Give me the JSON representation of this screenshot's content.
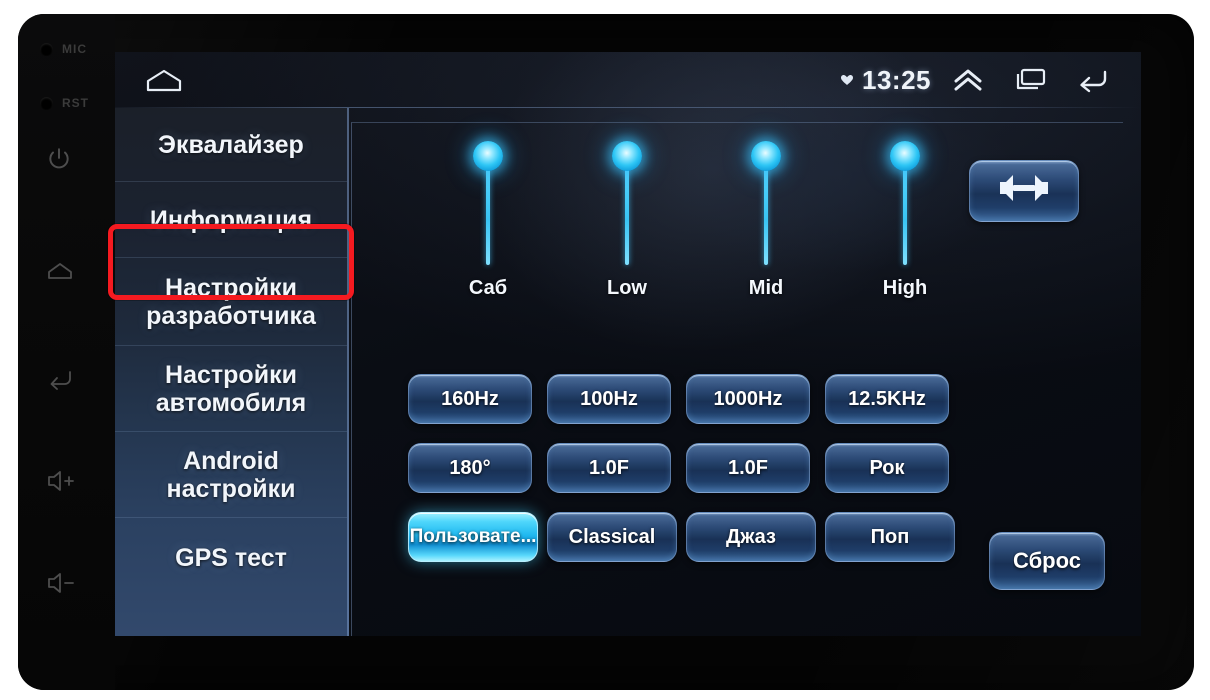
{
  "device": {
    "bezel_buttons": [
      {
        "name": "mic",
        "label": "MIC",
        "kind": "hole"
      },
      {
        "name": "reset",
        "label": "RST",
        "kind": "hole"
      },
      {
        "name": "power",
        "label": "",
        "kind": "icon"
      },
      {
        "name": "home",
        "label": "",
        "kind": "icon"
      },
      {
        "name": "back",
        "label": "",
        "kind": "icon"
      },
      {
        "name": "volume-up",
        "label": "",
        "kind": "icon"
      },
      {
        "name": "volume-down",
        "label": "",
        "kind": "icon"
      }
    ]
  },
  "statusbar": {
    "home_icon": "home-icon",
    "bluetooth_icon": "bluetooth-icon",
    "time": "13:25",
    "expand_icon": "double-chevron-up-icon",
    "recents_icon": "recent-apps-icon",
    "back_icon": "back-arrow-icon"
  },
  "sidebar": {
    "items": [
      {
        "label": "Эквалайзер",
        "lines": [
          "Эквалайзер"
        ],
        "selected": false,
        "highlighted": false
      },
      {
        "label": "Информация",
        "lines": [
          "Информация"
        ],
        "selected": false,
        "highlighted": true
      },
      {
        "label": "Настройки разработчика",
        "lines": [
          "Настройки",
          "разработчика"
        ],
        "selected": false,
        "highlighted": false
      },
      {
        "label": "Настройки автомобиля",
        "lines": [
          "Настройки",
          "автомобиля"
        ],
        "selected": false,
        "highlighted": false
      },
      {
        "label": "Android настройки",
        "lines": [
          "Android",
          "настройки"
        ],
        "selected": false,
        "highlighted": false
      },
      {
        "label": "GPS тест",
        "lines": [
          "GPS тест"
        ],
        "selected": false,
        "highlighted": false
      }
    ]
  },
  "equalizer": {
    "sliders": [
      {
        "label": "Саб",
        "value": 100
      },
      {
        "label": "Low",
        "value": 100
      },
      {
        "label": "Mid",
        "value": 100
      },
      {
        "label": "High",
        "value": 100
      }
    ],
    "rows": [
      [
        {
          "label": "160Hz",
          "active": false
        },
        {
          "label": "100Hz",
          "active": false
        },
        {
          "label": "1000Hz",
          "active": false
        },
        {
          "label": "12.5KHz",
          "active": false
        }
      ],
      [
        {
          "label": "180°",
          "active": false
        },
        {
          "label": "1.0F",
          "active": false
        },
        {
          "label": "1.0F",
          "active": false
        },
        {
          "label": "Рок",
          "active": false
        }
      ],
      [
        {
          "label": "Пользовате...",
          "active": true
        },
        {
          "label": "Classical",
          "active": false
        },
        {
          "label": "Джаз",
          "active": false
        },
        {
          "label": "Поп",
          "active": false
        }
      ]
    ],
    "balance_button": {
      "icon": "balance-speakers-icon",
      "label": ""
    },
    "reset_button": {
      "label": "Сброс"
    }
  },
  "annotation": {
    "highlight_color": "#f51a20",
    "target": "Информация"
  }
}
